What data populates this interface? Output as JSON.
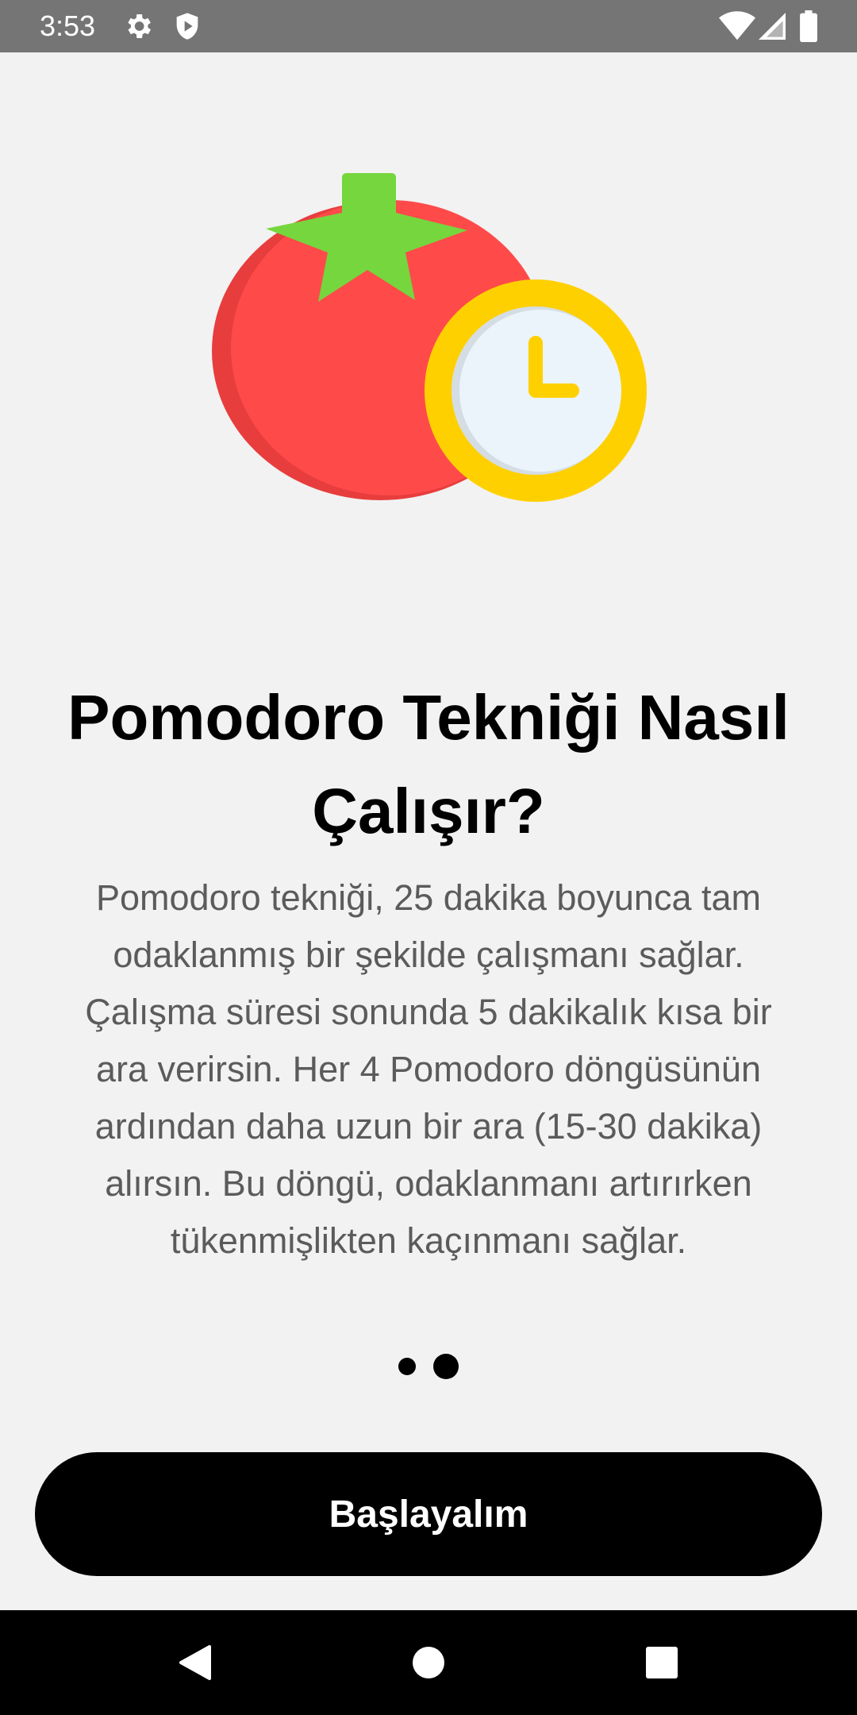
{
  "status_bar": {
    "time": "3:53",
    "left_icons": [
      "gear-icon",
      "shield-icon"
    ],
    "right_icons": [
      "wifi-icon",
      "cellular-icon",
      "battery-icon"
    ]
  },
  "onboarding": {
    "illustration": "tomato-clock-illustration",
    "title": "Pomodoro Tekniği Nasıl Çalışır?",
    "description_lines": [
      "Pomodoro tekniği, 25 dakika boyunca tam",
      "odaklanmış bir şekilde çalışmanı sağlar.",
      "Çalışma süresi sonunda 5 dakikalık kısa bir",
      "ara verirsin. Her 4 Pomodoro döngüsünün",
      "ardından daha uzun bir ara (15-30 dakika)",
      "alırsın. Bu döngü, odaklanmanı artırırken",
      "tükenmişlikten kaçınmanı sağlar."
    ],
    "page_indicator": {
      "total": 2,
      "current": 2
    },
    "button_label": "Başlayalım"
  },
  "nav_bar": {
    "icons": [
      "back-icon",
      "home-icon",
      "recents-icon"
    ]
  },
  "colors": {
    "tomato": "#ff4a4a",
    "tomato_shadow": "#e83d3d",
    "leaf": "#76d63d",
    "clock_ring": "#ffd000",
    "clock_face": "#ebf4fa",
    "button": "#000000"
  }
}
